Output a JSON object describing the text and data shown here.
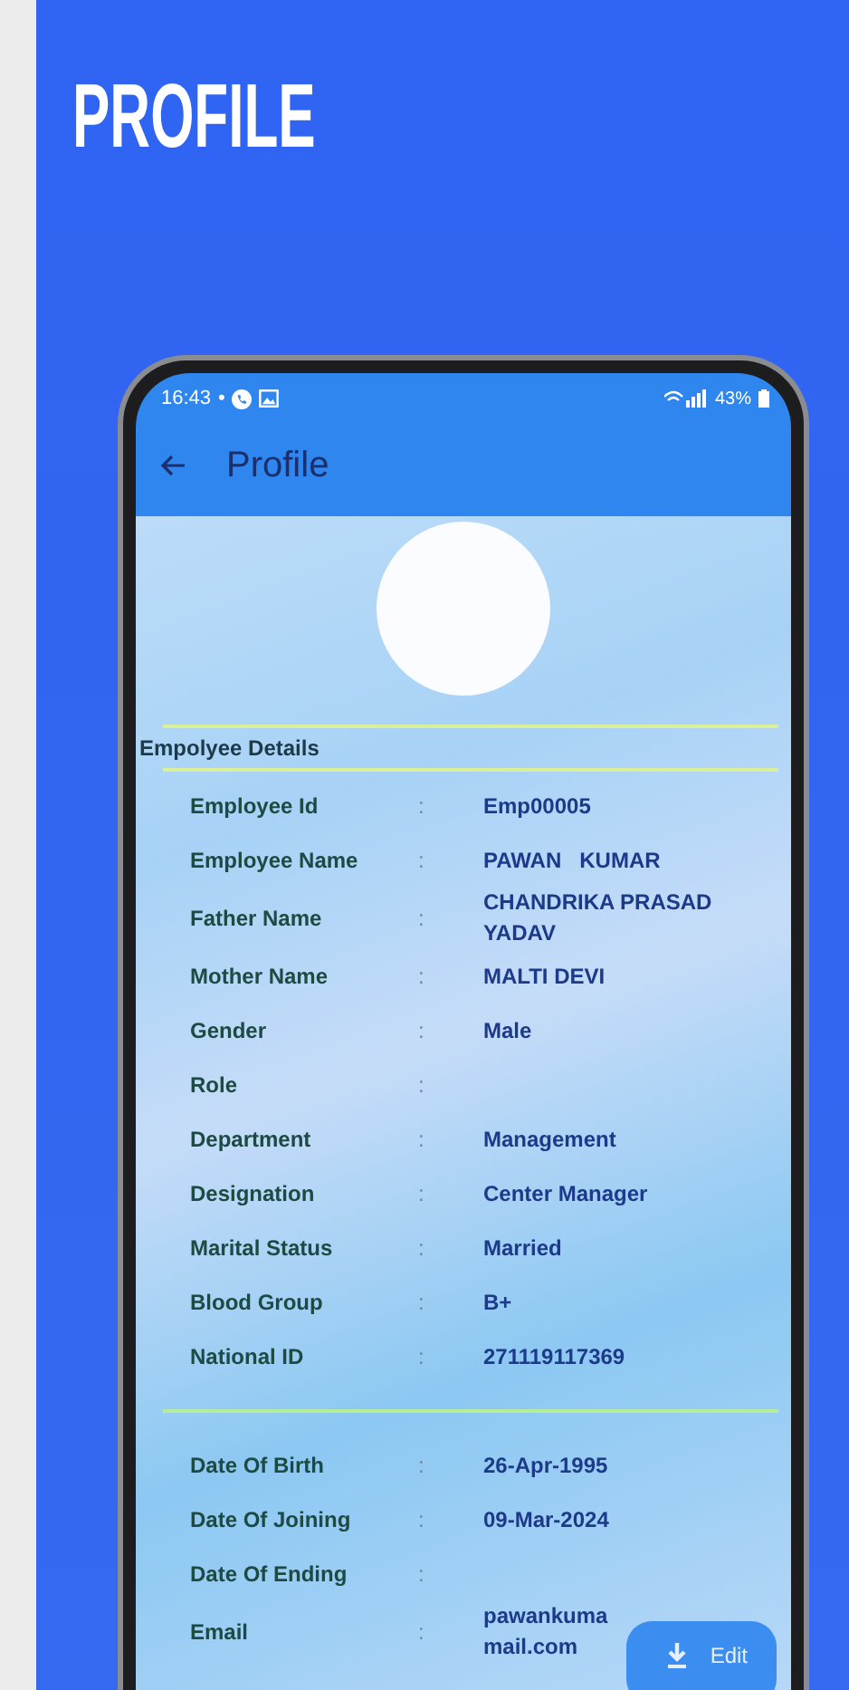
{
  "title": "PROFILE",
  "separator": ":",
  "status_bar": {
    "time": "16:43",
    "separator": "•",
    "battery": "43%"
  },
  "app_bar": {
    "title": "Profile"
  },
  "section_title": "Empolyee Details",
  "sections": [
    {
      "rows": [
        {
          "label": "Employee Id",
          "value": "Emp00005"
        },
        {
          "label": "Employee Name",
          "value": "PAWAN   KUMAR"
        },
        {
          "label": "Father Name",
          "value": "CHANDRIKA PRASAD YADAV"
        },
        {
          "label": "Mother Name",
          "value": "MALTI DEVI"
        },
        {
          "label": "Gender",
          "value": "Male"
        },
        {
          "label": "Role"
        },
        {
          "label": "Department",
          "value": "Management"
        },
        {
          "label": "Designation",
          "value": "Center Manager"
        },
        {
          "label": "Marital Status",
          "value": "Married"
        },
        {
          "label": "Blood Group",
          "value": "B+"
        },
        {
          "label": "National ID",
          "value": "271119117369"
        }
      ]
    },
    {
      "rows": [
        {
          "label": "Date Of Birth",
          "value": "26-Apr-1995"
        },
        {
          "label": "Date Of Joining",
          "value": "09-Mar-2024"
        },
        {
          "label": "Date Of Ending"
        },
        {
          "label": "Email",
          "value": "pawankuma mail.com"
        }
      ]
    }
  ],
  "fab": {
    "label": "Edit"
  }
}
